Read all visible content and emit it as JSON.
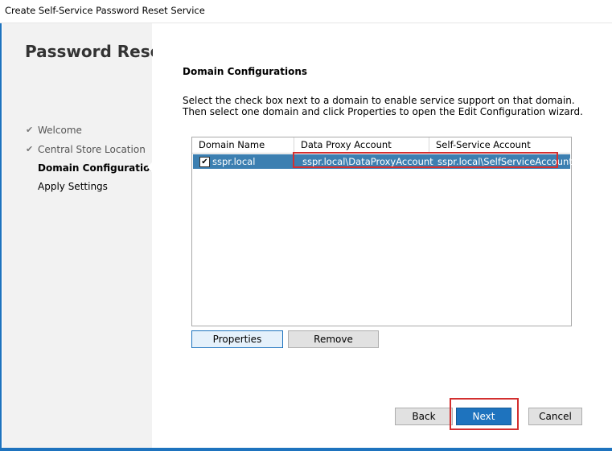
{
  "window": {
    "title": "Create Self-Service Password Reset Service"
  },
  "sidebar": {
    "title": "Password Reset",
    "steps": [
      {
        "label": "Welcome",
        "state": "done"
      },
      {
        "label": "Central Store Location",
        "state": "done"
      },
      {
        "label": "Domain Configurations",
        "state": "current"
      },
      {
        "label": "Apply Settings",
        "state": "pending"
      }
    ]
  },
  "main": {
    "section_title": "Domain Configurations",
    "instructions": "Select the check box next to a domain to enable service support on that domain. Then select one domain and click Properties to open the Edit Configuration wizard.",
    "table": {
      "columns": [
        "Domain Name",
        "Data Proxy Account",
        "Self-Service Account"
      ],
      "rows": [
        {
          "checked": true,
          "domain": "sspr.local",
          "data_proxy": "sspr.local\\DataProxyAccount",
          "self_service": "sspr.local\\SelfServiceAccount",
          "selected": true
        }
      ]
    },
    "buttons": {
      "properties": "Properties",
      "remove": "Remove"
    }
  },
  "footer": {
    "back": "Back",
    "next": "Next",
    "cancel": "Cancel"
  },
  "colors": {
    "accent": "#1e73be",
    "selection": "#3c7fb1",
    "annotation_red": "#d32f2f"
  }
}
